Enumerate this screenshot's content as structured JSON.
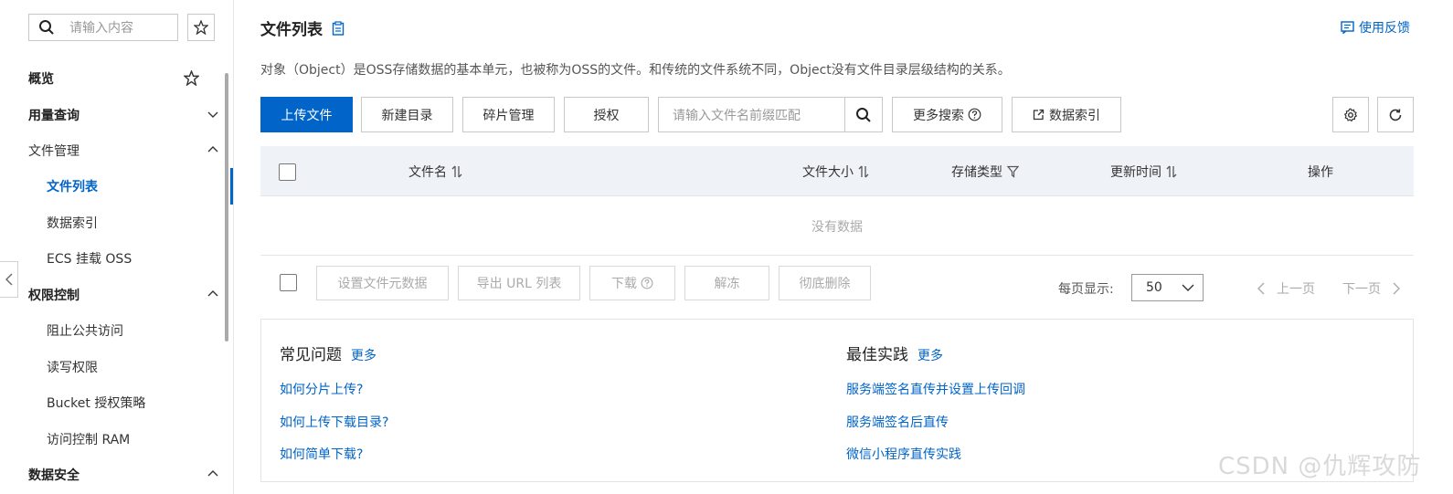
{
  "sidebar": {
    "search_placeholder": "请输入内容",
    "items": [
      {
        "label": "概览"
      },
      {
        "label": "用量查询"
      },
      {
        "label": "文件管理"
      },
      {
        "label": "文件列表"
      },
      {
        "label": "数据索引"
      },
      {
        "label": "ECS 挂载 OSS"
      },
      {
        "label": "权限控制"
      },
      {
        "label": "阻止公共访问"
      },
      {
        "label": "读写权限"
      },
      {
        "label": "Bucket 授权策略"
      },
      {
        "label": "访问控制 RAM"
      },
      {
        "label": "数据安全"
      }
    ]
  },
  "header": {
    "title": "文件列表",
    "feedback": "使用反馈",
    "description": "对象（Object）是OSS存储数据的基本单元，也被称为OSS的文件。和传统的文件系统不同，Object没有文件目录层级结构的关系。"
  },
  "toolbar": {
    "upload": "上传文件",
    "new_dir": "新建目录",
    "fragments": "碎片管理",
    "authorize": "授权",
    "search_placeholder": "请输入文件名前缀匹配",
    "more_search": "更多搜索",
    "data_index": "数据索引"
  },
  "table": {
    "columns": {
      "name": "文件名",
      "size": "文件大小",
      "storage": "存储类型",
      "updated": "更新时间",
      "actions": "操作"
    },
    "empty": "没有数据"
  },
  "bulk": {
    "set_meta": "设置文件元数据",
    "export_url": "导出 URL 列表",
    "download": "下载",
    "unfreeze": "解冻",
    "delete": "彻底删除"
  },
  "pagination": {
    "per_page_label": "每页显示:",
    "per_page_value": "50",
    "prev": "上一页",
    "next": "下一页"
  },
  "faq": {
    "title": "常见问题",
    "more": "更多",
    "links": [
      "如何分片上传?",
      "如何上传下载目录?",
      "如何简单下载?"
    ]
  },
  "best": {
    "title": "最佳实践",
    "more": "更多",
    "links": [
      "服务端签名直传并设置上传回调",
      "服务端签名后直传",
      "微信小程序直传实践"
    ]
  },
  "watermark": "CSDN @仇辉攻防",
  "colors": {
    "accent": "#0064c8",
    "header_bg": "#eff3f8"
  }
}
